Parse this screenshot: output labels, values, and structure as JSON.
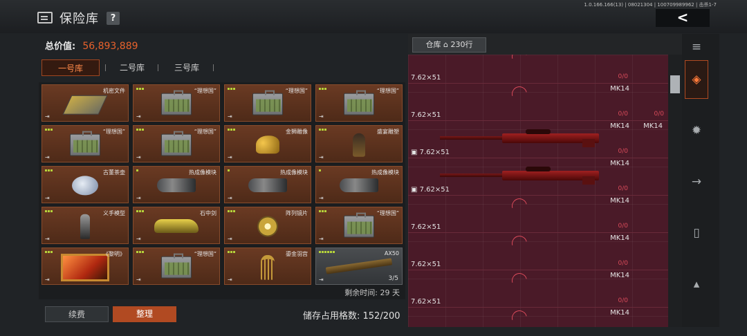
{
  "header": {
    "title": "保险库",
    "help_label": "?",
    "version_text": "1.0.166.166(13) | 08021304 | 100709989962 | 击杀1-7",
    "back_label": "<"
  },
  "summary": {
    "total_label": "总价值:",
    "total_value": "56,893,889"
  },
  "vault_tabs": [
    "一号库",
    "二号库",
    "三号库"
  ],
  "active_vault_tab": 0,
  "grid_items": [
    {
      "name": "机密文件",
      "dots": 0,
      "art": "doc"
    },
    {
      "name": "“理想国”",
      "dots": 3,
      "art": "case"
    },
    {
      "name": "“理想国”",
      "dots": 3,
      "art": "case"
    },
    {
      "name": "“理想国”",
      "dots": 3,
      "art": "case"
    },
    {
      "name": "“理想国”",
      "dots": 3,
      "art": "case"
    },
    {
      "name": "“理想国”",
      "dots": 3,
      "art": "case"
    },
    {
      "name": "金狮雕像",
      "dots": 3,
      "art": "lion"
    },
    {
      "name": "盛宴雕塑",
      "dots": 3,
      "art": "bust"
    },
    {
      "name": "古董茶壶",
      "dots": 3,
      "art": "teapot"
    },
    {
      "name": "热成像模块",
      "dots": 1,
      "art": "thermal"
    },
    {
      "name": "热成像模块",
      "dots": 1,
      "art": "thermal"
    },
    {
      "name": "热成像模块",
      "dots": 1,
      "art": "thermal"
    },
    {
      "name": "义手模型",
      "dots": 3,
      "art": "hand"
    },
    {
      "name": "石中剑",
      "dots": 3,
      "art": "car"
    },
    {
      "name": "阵列镜片",
      "dots": 3,
      "art": "disc"
    },
    {
      "name": "“理想国”",
      "dots": 3,
      "art": "case"
    },
    {
      "name": "《黎明》",
      "dots": 3,
      "art": "painting"
    },
    {
      "name": "“理想国”",
      "dots": 3,
      "art": "case"
    },
    {
      "name": "鎏金羽宫",
      "dots": 3,
      "art": "cage"
    },
    {
      "name": "AX50",
      "dots": 6,
      "art": "rifle",
      "count": "3/5",
      "grey": true
    }
  ],
  "remaining_text": "剩余时间: 29 天",
  "buttons": {
    "renew": "续费",
    "sort": "整理"
  },
  "storage_text": "储存占用格数: 152/200",
  "warehouse": {
    "label": "仓库",
    "rows": "230行"
  },
  "warehouse_rows": [
    {
      "ammo": "7.62×51",
      "weapon": "",
      "mag": "0/0",
      "weapon2": "",
      "mag2": "",
      "sniper": false
    },
    {
      "ammo": "7.62×51",
      "weapon": "MK14",
      "mag": "0/0",
      "weapon2": "",
      "mag2": "0/0",
      "sniper": false
    },
    {
      "ammo": "7.62×51",
      "weapon": "MK14",
      "mag": "0/0",
      "weapon2": "MK14",
      "mag2": "",
      "sniper": true
    },
    {
      "ammo": "7.62×51",
      "weapon": "MK14",
      "mag": "0/0",
      "weapon2": "",
      "mag2": "",
      "sniper": true
    },
    {
      "ammo": "7.62×51",
      "weapon": "MK14",
      "mag": "0/0",
      "weapon2": "",
      "mag2": "",
      "sniper": false
    },
    {
      "ammo": "7.62×51",
      "weapon": "MK14",
      "mag": "0/0",
      "weapon2": "",
      "mag2": "",
      "sniper": false
    },
    {
      "ammo": "7.62×51",
      "weapon": "MK14",
      "mag": "0/0",
      "weapon2": "",
      "mag2": "",
      "sniper": false
    },
    {
      "ammo": "",
      "weapon": "MK14",
      "mag": "",
      "weapon2": "",
      "mag2": "",
      "sniper": false
    }
  ],
  "side_tabs": [
    "stack-refresh-icon",
    "layers-icon",
    "grenade-icon",
    "rifle-icon",
    "magazine-icon",
    "ammo-icon"
  ],
  "colors": {
    "accent": "#b14a22",
    "total_value": "#e8622c",
    "slot_bg": "#5a3020",
    "warehouse_bg": "#4a1a28"
  }
}
